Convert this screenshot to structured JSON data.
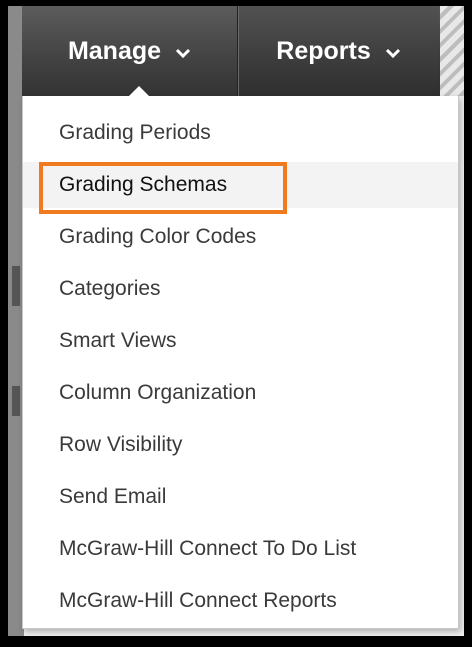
{
  "nav": {
    "manage_label": "Manage",
    "reports_label": "Reports",
    "chevron_glyph": "⌄"
  },
  "menu": {
    "items": [
      {
        "label": "Grading Periods"
      },
      {
        "label": "Grading Schemas",
        "highlighted": true
      },
      {
        "label": "Grading Color Codes"
      },
      {
        "label": "Categories"
      },
      {
        "label": "Smart Views"
      },
      {
        "label": "Column Organization"
      },
      {
        "label": "Row Visibility"
      },
      {
        "label": "Send Email"
      },
      {
        "label": "McGraw-Hill Connect To Do List"
      },
      {
        "label": "McGraw-Hill Connect Reports"
      }
    ]
  },
  "colors": {
    "highlight_border": "#f07a20",
    "navbar": "#3c3c3c",
    "menu_text": "#3a3a3a"
  }
}
